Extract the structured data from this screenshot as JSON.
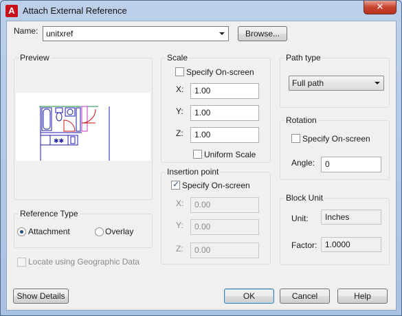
{
  "window": {
    "title": "Attach External Reference",
    "app_icon_glyph": "A",
    "close_glyph": "✕"
  },
  "name": {
    "label": "Name:",
    "value": "unitxref",
    "browse_label": "Browse..."
  },
  "preview": {
    "title": "Preview"
  },
  "scale": {
    "title": "Scale",
    "specify_label": "Specify On-screen",
    "specify_checked": false,
    "x_label": "X:",
    "x_value": "1.00",
    "y_label": "Y:",
    "y_value": "1.00",
    "z_label": "Z:",
    "z_value": "1.00",
    "uniform_label": "Uniform Scale",
    "uniform_checked": false
  },
  "insertion": {
    "title": "Insertion point",
    "specify_label": "Specify On-screen",
    "specify_checked": true,
    "x_label": "X:",
    "x_value": "0.00",
    "y_label": "Y:",
    "y_value": "0.00",
    "z_label": "Z:",
    "z_value": "0.00"
  },
  "path_type": {
    "title": "Path type",
    "value": "Full path"
  },
  "rotation": {
    "title": "Rotation",
    "specify_label": "Specify On-screen",
    "specify_checked": false,
    "angle_label": "Angle:",
    "angle_value": "0"
  },
  "block_unit": {
    "title": "Block Unit",
    "unit_label": "Unit:",
    "unit_value": "Inches",
    "factor_label": "Factor:",
    "factor_value": "1.0000"
  },
  "reference_type": {
    "title": "Reference Type",
    "attachment_label": "Attachment",
    "overlay_label": "Overlay",
    "selected": "Attachment"
  },
  "geo": {
    "label": "Locate using Geographic Data",
    "checked": false
  },
  "footer": {
    "show_details_label": "Show Details",
    "ok_label": "OK",
    "cancel_label": "Cancel",
    "help_label": "Help"
  },
  "colors": {
    "preview_blue": "#1a1aa8",
    "preview_red": "#d01010",
    "preview_magenta": "#cc33cc",
    "preview_green": "#1a8a3a",
    "title_accent": "#c8101a"
  }
}
